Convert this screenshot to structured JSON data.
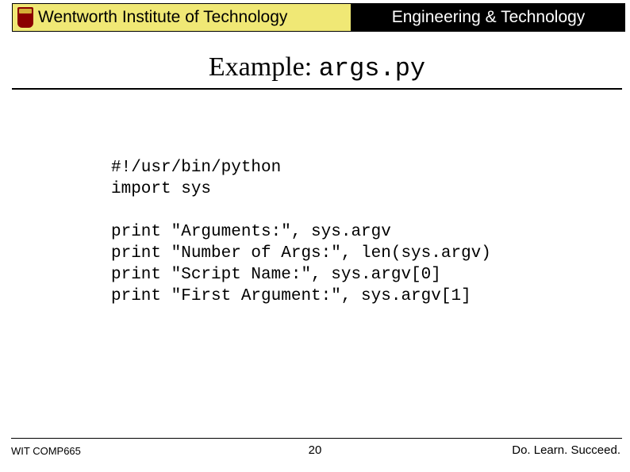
{
  "header": {
    "institution": "Wentworth Institute of Technology",
    "department": "Engineering & Technology"
  },
  "title": {
    "prefix": "Example: ",
    "code": "args.py"
  },
  "code": {
    "line1": "#!/usr/bin/python",
    "line2": "import sys",
    "line3": "",
    "line4": "print \"Arguments:\", sys.argv",
    "line5": "print \"Number of Args:\", len(sys.argv)",
    "line6": "print \"Script Name:\", sys.argv[0]",
    "line7": "print \"First Argument:\", sys.argv[1]"
  },
  "footer": {
    "course": "WIT COMP665",
    "page": "20",
    "motto": "Do. Learn. Succeed."
  }
}
